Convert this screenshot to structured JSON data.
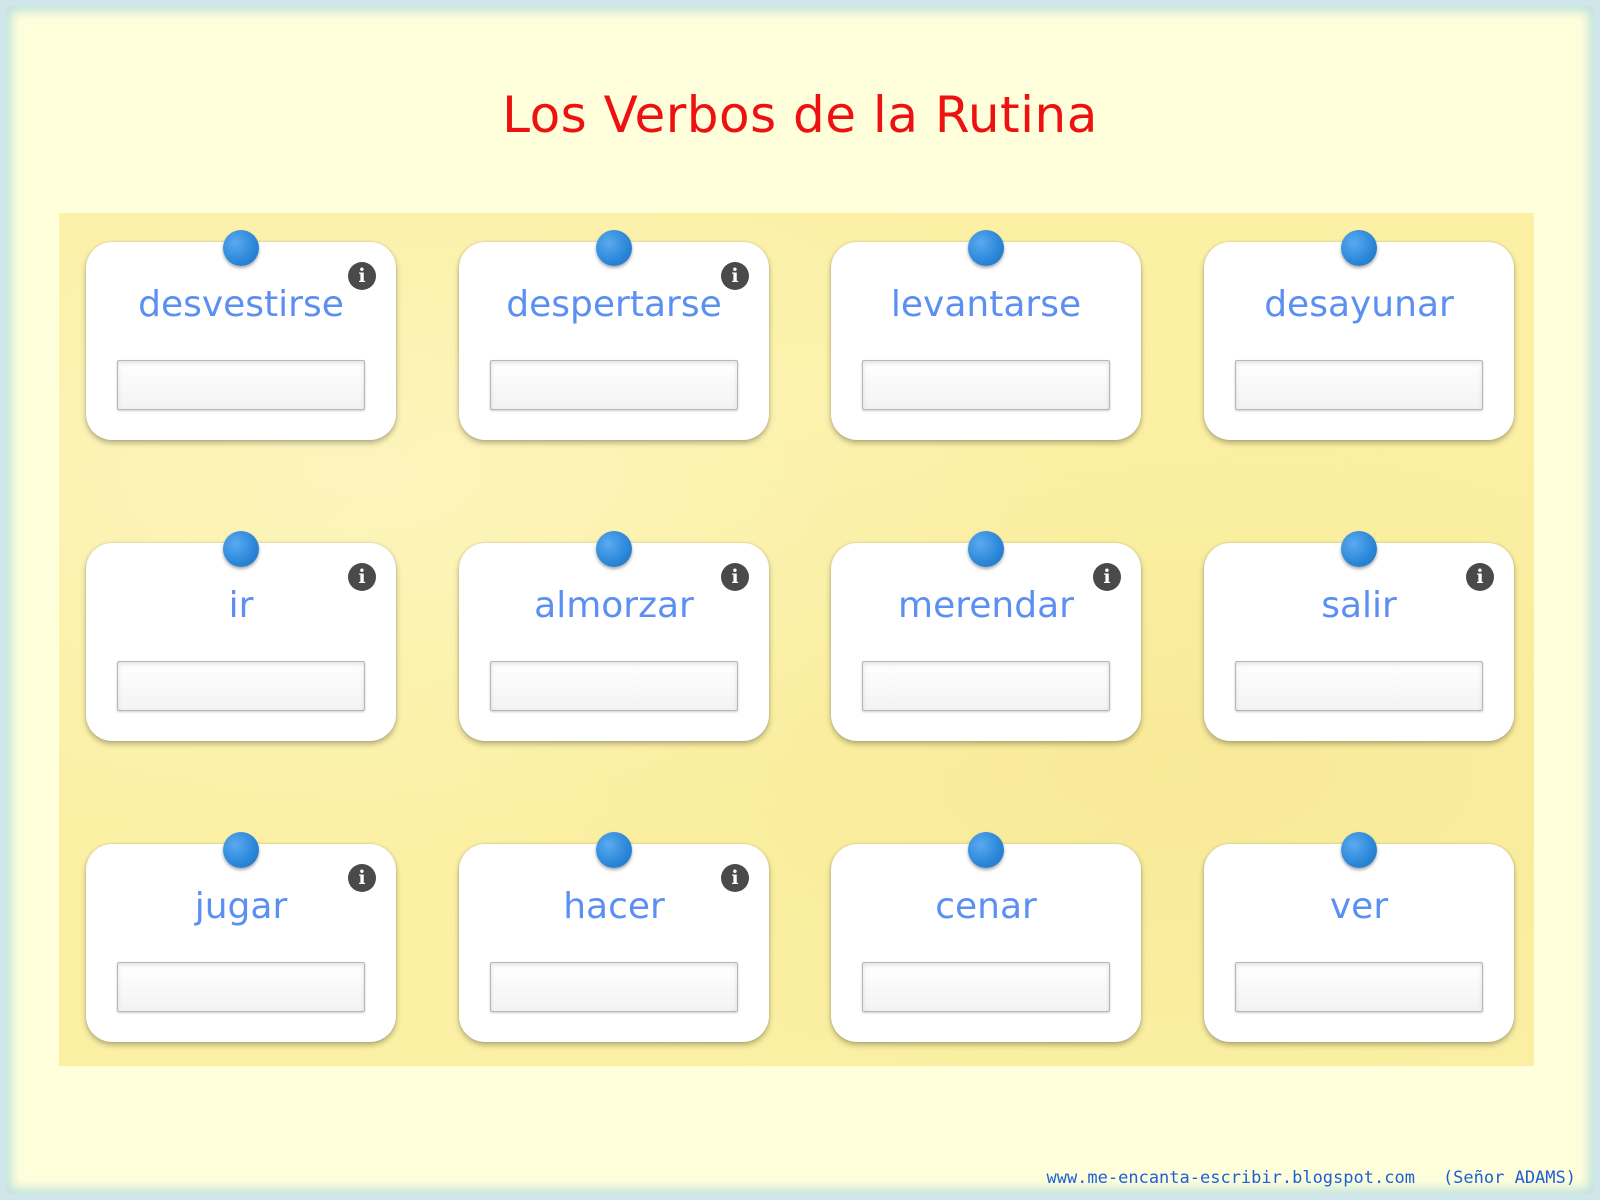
{
  "title": "Los Verbos de la Rutina",
  "colors": {
    "title": "#ee1111",
    "word": "#5b8ff2",
    "pin": "#2a86d8",
    "board": "#fbf0a4",
    "page": "#ffffdc"
  },
  "cards": [
    {
      "word": "desvestirse",
      "answer": "",
      "info_icon": true
    },
    {
      "word": "despertarse",
      "answer": "",
      "info_icon": true
    },
    {
      "word": "levantarse",
      "answer": "",
      "info_icon": false
    },
    {
      "word": "desayunar",
      "answer": "",
      "info_icon": false
    },
    {
      "word": "ir",
      "answer": "",
      "info_icon": true
    },
    {
      "word": "almorzar",
      "answer": "",
      "info_icon": true
    },
    {
      "word": "merendar",
      "answer": "",
      "info_icon": true
    },
    {
      "word": "salir",
      "answer": "",
      "info_icon": true
    },
    {
      "word": "jugar",
      "answer": "",
      "info_icon": true
    },
    {
      "word": "hacer",
      "answer": "",
      "info_icon": true
    },
    {
      "word": "cenar",
      "answer": "",
      "info_icon": false
    },
    {
      "word": "ver",
      "answer": "",
      "info_icon": false
    }
  ],
  "info_glyph": "i",
  "footer": {
    "url": "www.me-encanta-escribir.blogspot.com",
    "credit": "(Señor ADAMS)"
  }
}
